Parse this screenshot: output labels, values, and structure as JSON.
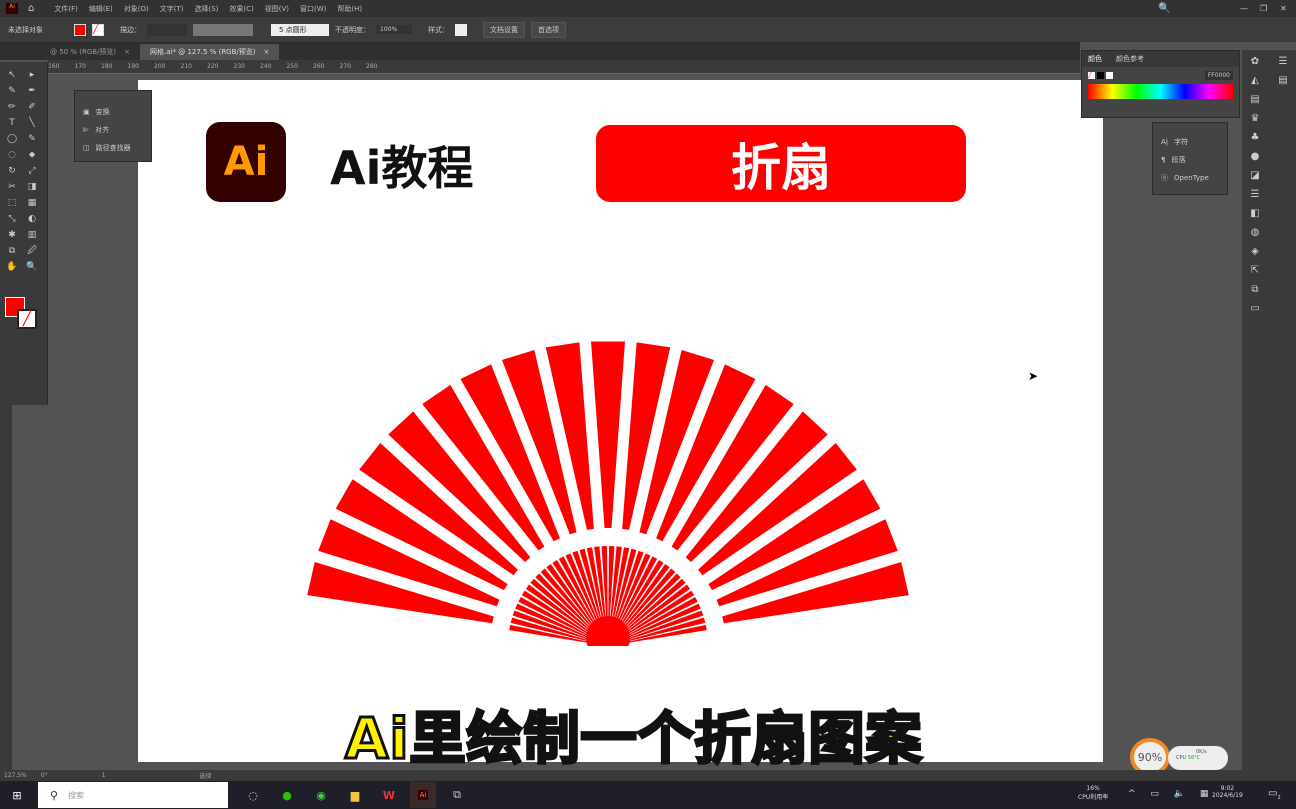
{
  "app": {
    "logo": "Ai"
  },
  "menu": [
    "文件(F)",
    "编辑(E)",
    "对象(O)",
    "文字(T)",
    "选择(S)",
    "效果(C)",
    "视图(V)",
    "窗口(W)",
    "帮助(H)"
  ],
  "control": {
    "selection": "未选择对象",
    "stroke_label": "描边：",
    "brush": "5 点圆形",
    "opacity_label": "不透明度：",
    "opacity": "100%",
    "style_label": "样式：",
    "doc_setup": "文档设置",
    "preferences": "首选项",
    "fill_color": "#ff0000"
  },
  "tabs": [
    {
      "label": "@ 50 % (RGB/预览)"
    },
    {
      "label": "网格.ai* @ 127.5 % (RGB/预览)"
    }
  ],
  "ruler": [
    "160",
    "170",
    "180",
    "190",
    "200",
    "210",
    "220",
    "230",
    "240",
    "250",
    "260",
    "270",
    "280"
  ],
  "float_panel": [
    "变换",
    "对齐",
    "路径查找器"
  ],
  "color_panel": {
    "tabs": [
      "颜色",
      "颜色参考"
    ],
    "hex": "FF0000"
  },
  "type_panel": [
    "字符",
    "段落",
    "OpenType"
  ],
  "artboard": {
    "logo": "Ai",
    "heading": "Ai教程",
    "badge": "折扇",
    "accent": "#ff0000",
    "logo_bg": "#330000",
    "logo_fg": "#ff9a00"
  },
  "subtitle": "Ai里绘制一个折扇图案",
  "status": {
    "zoom": "127.5%",
    "rotation": "0°",
    "artboard_num": "1",
    "tool": "选择"
  },
  "widget": {
    "percent": "90%",
    "cpu_label": "CPU",
    "temp": "56°C",
    "speed": "0K/s"
  },
  "taskbar": {
    "search_placeholder": "搜索",
    "cpu_pct": "16%",
    "cpu_label": "CPU利用率",
    "time": "9:02",
    "date": "2024/6/19",
    "notif": "2"
  }
}
